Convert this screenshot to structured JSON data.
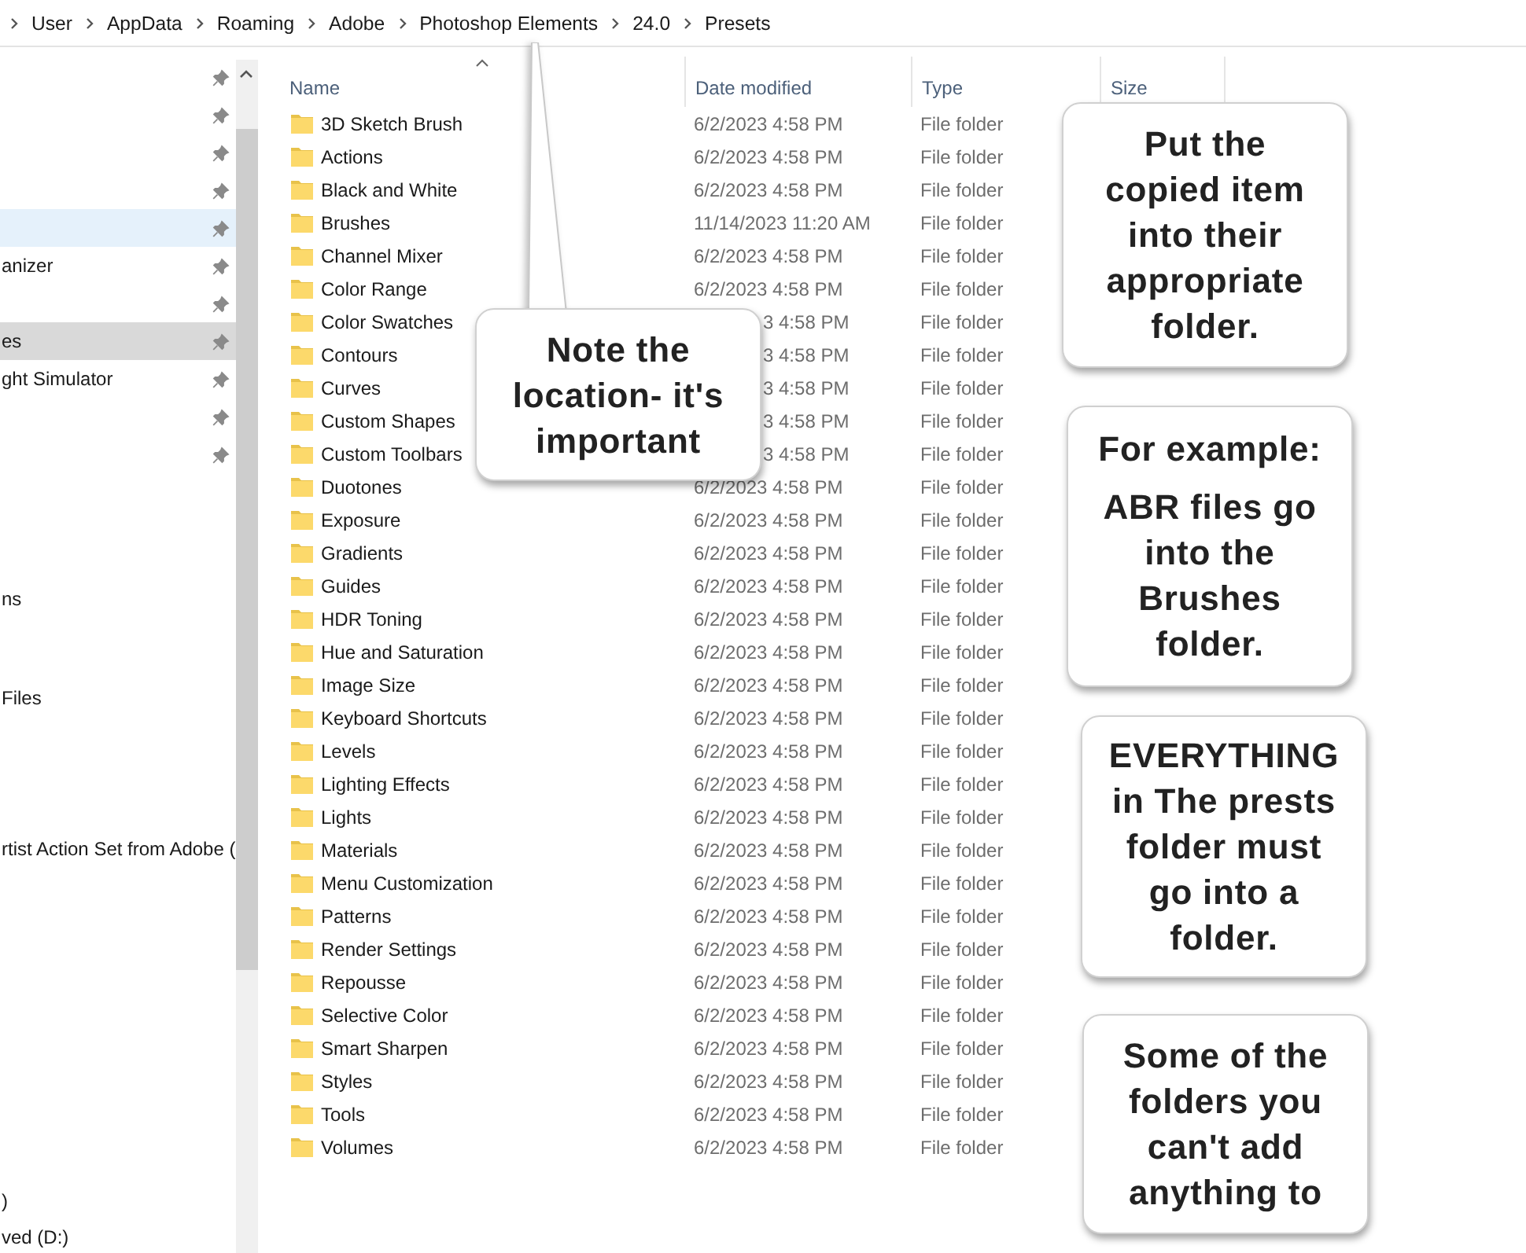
{
  "breadcrumb": [
    {
      "label": "User"
    },
    {
      "label": "AppData"
    },
    {
      "label": "Roaming"
    },
    {
      "label": "Adobe"
    },
    {
      "label": "Photoshop Elements"
    },
    {
      "label": "24.0"
    },
    {
      "label": "Presets"
    }
  ],
  "sidebar": {
    "items": [
      {
        "pinned": true,
        "selected": false,
        "highlighted": false
      },
      {
        "pinned": true,
        "selected": false,
        "highlighted": false
      },
      {
        "pinned": true,
        "selected": false,
        "highlighted": false
      },
      {
        "pinned": true,
        "selected": false,
        "highlighted": false
      },
      {
        "pinned": true,
        "selected": false,
        "highlighted": true
      },
      {
        "label": "anizer",
        "pinned": true,
        "selected": false,
        "highlighted": false
      },
      {
        "pinned": true,
        "selected": false,
        "highlighted": false
      },
      {
        "label": "es",
        "pinned": true,
        "selected": true,
        "highlighted": false
      },
      {
        "label": "ght Simulator",
        "pinned": true,
        "selected": false,
        "highlighted": false
      },
      {
        "pinned": true,
        "selected": false,
        "highlighted": false
      },
      {
        "pinned": true,
        "selected": false,
        "highlighted": false
      }
    ],
    "more_items": [
      {
        "label": "ns"
      },
      {
        "label": "Files"
      },
      {
        "label": "rtist Action Set from Adobe ("
      },
      {
        "label": ")"
      },
      {
        "label": "ved (D:)"
      }
    ]
  },
  "table": {
    "columns": [
      {
        "label": "Name",
        "sorted": true
      },
      {
        "label": "Date modified",
        "sorted": false
      },
      {
        "label": "Type",
        "sorted": false
      },
      {
        "label": "Size",
        "sorted": false
      }
    ],
    "rows": [
      {
        "name": "3D Sketch Brush",
        "date": "6/2/2023 4:58 PM",
        "type": "File folder"
      },
      {
        "name": "Actions",
        "date": "6/2/2023 4:58 PM",
        "type": "File folder"
      },
      {
        "name": "Black and White",
        "date": "6/2/2023 4:58 PM",
        "type": "File folder"
      },
      {
        "name": "Brushes",
        "date": "11/14/2023 11:20 AM",
        "type": "File folder"
      },
      {
        "name": "Channel Mixer",
        "date": "6/2/2023 4:58 PM",
        "type": "File folder"
      },
      {
        "name": "Color Range",
        "date": "6/2/2023 4:58 PM",
        "type": "File folder"
      },
      {
        "name": "Color Swatches",
        "date": "3 4:58 PM",
        "date_covered": true,
        "type": "File folder"
      },
      {
        "name": "Contours",
        "date": "3 4:58 PM",
        "date_covered": true,
        "type": "File folder"
      },
      {
        "name": "Curves",
        "date": "3 4:58 PM",
        "date_covered": true,
        "type": "File folder"
      },
      {
        "name": "Custom Shapes",
        "date": "3 4:58 PM",
        "date_covered": true,
        "type": "File folder"
      },
      {
        "name": "Custom Toolbars",
        "date": "3 4:58 PM",
        "date_covered": true,
        "type": "File folder"
      },
      {
        "name": "Duotones",
        "date": "6/2/2023 4:58 PM",
        "type": "File folder"
      },
      {
        "name": "Exposure",
        "date": "6/2/2023 4:58 PM",
        "type": "File folder"
      },
      {
        "name": "Gradients",
        "date": "6/2/2023 4:58 PM",
        "type": "File folder"
      },
      {
        "name": "Guides",
        "date": "6/2/2023 4:58 PM",
        "type": "File folder"
      },
      {
        "name": "HDR Toning",
        "date": "6/2/2023 4:58 PM",
        "type": "File folder"
      },
      {
        "name": "Hue and Saturation",
        "date": "6/2/2023 4:58 PM",
        "type": "File folder"
      },
      {
        "name": "Image Size",
        "date": "6/2/2023 4:58 PM",
        "type": "File folder"
      },
      {
        "name": "Keyboard Shortcuts",
        "date": "6/2/2023 4:58 PM",
        "type": "File folder"
      },
      {
        "name": "Levels",
        "date": "6/2/2023 4:58 PM",
        "type": "File folder"
      },
      {
        "name": "Lighting Effects",
        "date": "6/2/2023 4:58 PM",
        "type": "File folder"
      },
      {
        "name": "Lights",
        "date": "6/2/2023 4:58 PM",
        "type": "File folder"
      },
      {
        "name": "Materials",
        "date": "6/2/2023 4:58 PM",
        "type": "File folder"
      },
      {
        "name": "Menu Customization",
        "date": "6/2/2023 4:58 PM",
        "type": "File folder"
      },
      {
        "name": "Patterns",
        "date": "6/2/2023 4:58 PM",
        "type": "File folder"
      },
      {
        "name": "Render Settings",
        "date": "6/2/2023 4:58 PM",
        "type": "File folder"
      },
      {
        "name": "Repousse",
        "date": "6/2/2023 4:58 PM",
        "type": "File folder"
      },
      {
        "name": "Selective Color",
        "date": "6/2/2023 4:58 PM",
        "type": "File folder"
      },
      {
        "name": "Smart Sharpen",
        "date": "6/2/2023 4:58 PM",
        "type": "File folder"
      },
      {
        "name": "Styles",
        "date": "6/2/2023 4:58 PM",
        "type": "File folder"
      },
      {
        "name": "Tools",
        "date": "6/2/2023 4:58 PM",
        "type": "File folder"
      },
      {
        "name": "Volumes",
        "date": "6/2/2023 4:58 PM",
        "type": "File folder"
      }
    ]
  },
  "callouts": [
    {
      "text": "Note the location- it's important",
      "pointer": true
    },
    {
      "text": "Put the copied item into their appropriate folder.",
      "pointer": false
    },
    {
      "text": "For example:\nABR files go into the Brushes folder.",
      "pointer": false
    },
    {
      "text": "EVERYTHING in The prests folder must go into a folder.",
      "pointer": false
    },
    {
      "text": "Some of the folders you can't add anything to",
      "pointer": false
    }
  ]
}
